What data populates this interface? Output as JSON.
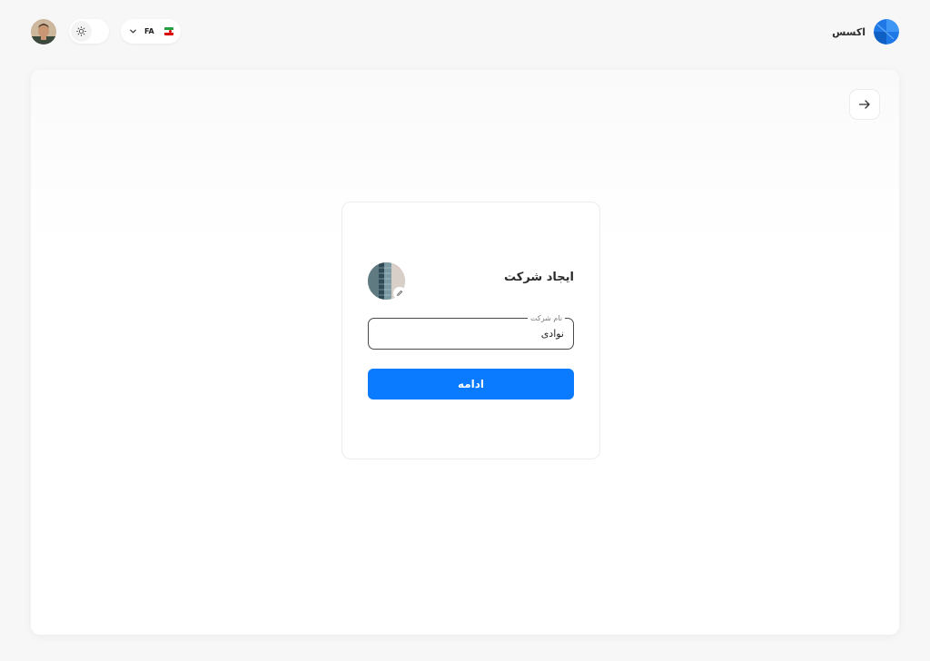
{
  "header": {
    "brand_name": "اکسس",
    "brand_color": "#1a73e8",
    "language": {
      "code": "FA",
      "flag": "iran-flag",
      "flag_colors": [
        "#239f40",
        "#ffffff",
        "#da0000"
      ],
      "icon": "chevron-down-icon"
    },
    "theme_toggle": {
      "icon": "sun-icon",
      "state": "light"
    },
    "user_avatar": "avatar"
  },
  "panel": {
    "back_icon": "arrow-right-icon"
  },
  "card": {
    "title": "ایجاد شرکت",
    "logo_edit_icon": "pencil-icon",
    "company_name_field": {
      "label": "نام شرکت",
      "value": "نوادی"
    },
    "continue_label": "ادامه",
    "accent_color": "#0a7bff"
  }
}
